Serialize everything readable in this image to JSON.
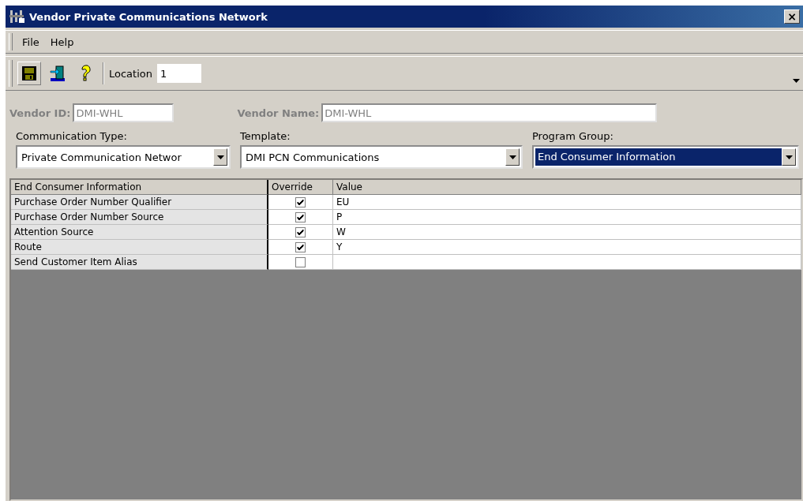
{
  "window": {
    "title": "Vendor Private Communications Network",
    "close": "×"
  },
  "menu": [
    "File",
    "Help"
  ],
  "toolbar": {
    "location_label": "Location",
    "location_value": "1"
  },
  "vendor_id": {
    "label": "Vendor ID:",
    "value": "DMI-WHL",
    "disabled": true
  },
  "vendor_name": {
    "label": "Vendor Name:",
    "value": "DMI-WHL",
    "disabled": true
  },
  "combos": [
    {
      "label": "Communication Type:",
      "value": "Private Communication Networ",
      "selected": false
    },
    {
      "label": "Template:",
      "value": "DMI PCN Communications",
      "selected": false
    },
    {
      "label": "Program Group:",
      "value": "End Consumer Information",
      "selected": true
    }
  ],
  "grid": {
    "columns": [
      "End Consumer Information",
      "Override",
      "Value"
    ],
    "rows": [
      {
        "name": "Purchase Order Number Qualifier",
        "checked": true,
        "value": "EU"
      },
      {
        "name": "Purchase Order Number Source",
        "checked": true,
        "value": "P"
      },
      {
        "name": "Attention Source",
        "checked": true,
        "value": "W"
      },
      {
        "name": "Route",
        "checked": true,
        "value": "Y"
      },
      {
        "name": "Send Customer Item Alias",
        "checked": false
      }
    ]
  }
}
